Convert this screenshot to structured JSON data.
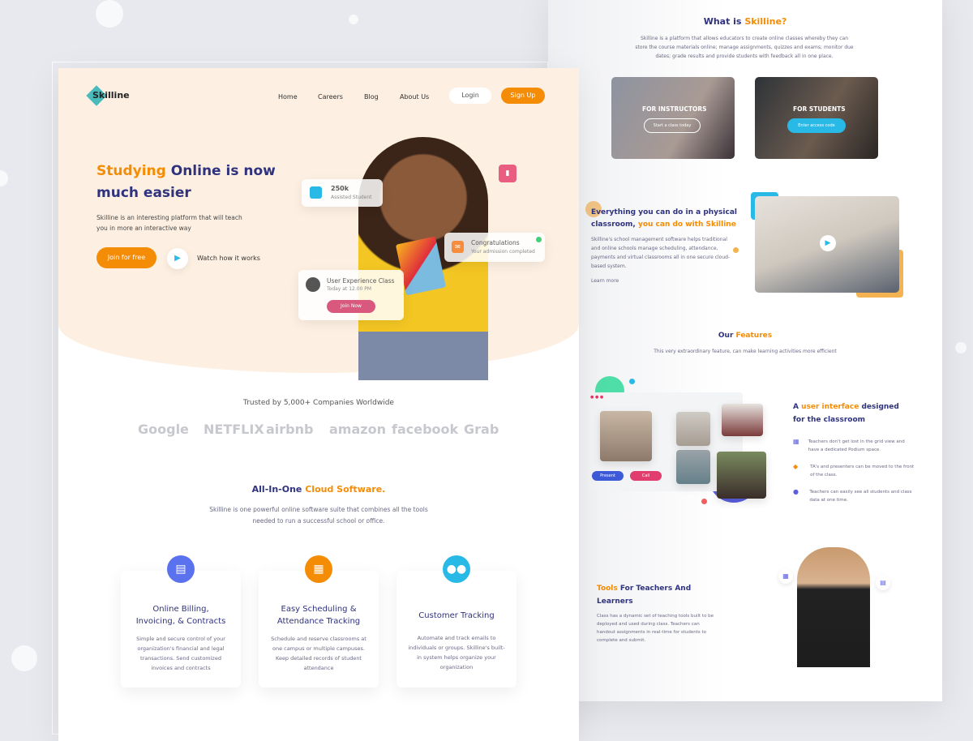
{
  "colors": {
    "navy": "#2f327d",
    "orange": "#f48c06",
    "blue": "#49bbbd",
    "peach": "#fdf0e2",
    "pink": "#d8587e"
  },
  "left": {
    "brand": "Skilline",
    "nav": [
      "Home",
      "Careers",
      "Blog",
      "About Us"
    ],
    "login": "Login",
    "signup": "Sign Up",
    "hero": {
      "title_accent": "Studying",
      "title_rest": " Online is now much easier",
      "desc": "Skilline is an interesting platform that will teach you in more an interactive way",
      "join": "Join for free",
      "watch": "Watch how it works"
    },
    "floats": {
      "stat_value": "250k",
      "stat_label": "Assisted Student",
      "congrats_title": "Congratulations",
      "congrats_sub": "Your admission completed",
      "class_title": "User Experience Class",
      "class_time": "Today at 12.00 PM",
      "join_now": "Join Now"
    },
    "trusted": "Trusted by 5,000+ Companies Worldwide",
    "logos": [
      "Google",
      "NETFLIX",
      "airbnb",
      "amazon",
      "facebook",
      "Grab"
    ],
    "allinone": {
      "title_main": "All-In-One ",
      "title_accent": "Cloud Software.",
      "desc": "Skilline is one powerful online software suite that combines all the tools needed to run a successful school or office."
    },
    "features": [
      {
        "icon": "document-icon",
        "color": "#5b72ee",
        "title": "Online Billing, Invoicing, & Contracts",
        "desc": "Simple and secure control of your organization's financial and legal transactions. Send customized invoices and contracts"
      },
      {
        "icon": "calendar-icon",
        "color": "#f48c06",
        "title": "Easy Scheduling & Attendance Tracking",
        "desc": "Schedule and reserve classrooms at one campus or multiple campuses. Keep detailed records of student attendance"
      },
      {
        "icon": "users-icon",
        "color": "#29b9e7",
        "title": "Customer Tracking",
        "desc": "Automate and track emails to individuals or groups. Skilline's built-in system helps organize your organization"
      }
    ]
  },
  "right": {
    "what": {
      "title_main": "What is ",
      "title_accent": "Skilline?",
      "desc": "Skilline is a platform that allows educators to create online classes whereby they can store the course materials online; manage assignments, quizzes and exams; monitor due dates; grade results and provide students with feedback all in one place."
    },
    "instructors": {
      "label": "FOR INSTRUCTORS",
      "button": "Start a class today"
    },
    "students": {
      "label": "FOR STUDENTS",
      "button": "Enter access code"
    },
    "everything": {
      "title_main": "Everything you can do in a physical classroom, ",
      "title_accent": "you can do with Skilline",
      "desc": "Skilline's school management software helps traditional and online schools manage scheduling, attendance, payments and virtual classrooms all in one secure cloud-based system.",
      "link": "Learn more"
    },
    "features": {
      "title_main": "Our ",
      "title_accent": "Features",
      "desc": "This very extraordinary feature, can make learning activities more efficient"
    },
    "ui": {
      "title_a": "A ",
      "title_accent": "user interface",
      "title_b": " designed for the classroom",
      "present": "Present",
      "call": "Call",
      "items": [
        "Teachers don't get lost in the grid view and have a dedicated Podium space.",
        "TA's and presenters can be moved to the front of the class.",
        "Teachers can easily see all students and class data at one time."
      ]
    },
    "tools": {
      "title_accent": "Tools",
      "title_main": " For Teachers And Learners",
      "desc": "Class has a dynamic set of teaching tools built to be deployed and used during class. Teachers can handout assignments in real-time for students to complete and submit."
    }
  }
}
